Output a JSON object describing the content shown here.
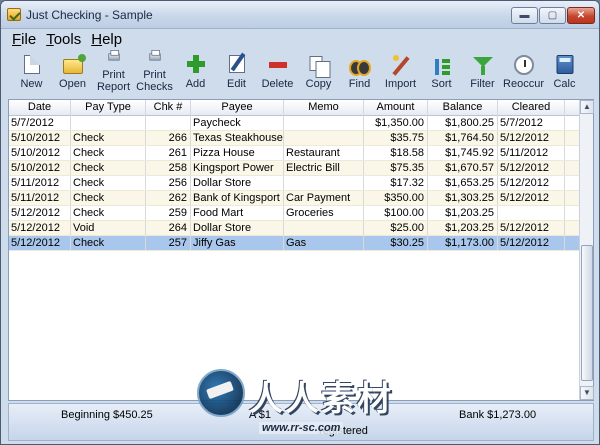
{
  "window": {
    "title": "Just Checking - Sample",
    "buttons": {
      "min": "▬",
      "max": "▢",
      "close": "✕"
    }
  },
  "menu": [
    "File",
    "Tools",
    "Help"
  ],
  "toolbar": [
    {
      "label": "New",
      "icon": "new-document-icon"
    },
    {
      "label": "Open",
      "icon": "open-folder-icon"
    },
    {
      "label": "Print Report",
      "icon": "print-report-icon"
    },
    {
      "label": "Print Checks",
      "icon": "print-checks-icon"
    },
    {
      "label": "Add",
      "icon": "add-plus-icon"
    },
    {
      "label": "Edit",
      "icon": "edit-pencil-icon"
    },
    {
      "label": "Delete",
      "icon": "delete-minus-icon"
    },
    {
      "label": "Copy",
      "icon": "copy-icon"
    },
    {
      "label": "Find",
      "icon": "binoculars-icon"
    },
    {
      "label": "Import",
      "icon": "import-wand-icon"
    },
    {
      "label": "Sort",
      "icon": "sort-icon"
    },
    {
      "label": "Filter",
      "icon": "filter-funnel-icon"
    },
    {
      "label": "Reoccur",
      "icon": "reoccur-clock-icon"
    },
    {
      "label": "Calc",
      "icon": "calculator-icon"
    }
  ],
  "columns": [
    "Date",
    "Pay Type",
    "Chk #",
    "Payee",
    "Memo",
    "Amount",
    "Balance",
    "Cleared"
  ],
  "rows": [
    [
      "5/7/2012",
      "",
      "",
      "Paycheck",
      "",
      "$1,350.00",
      "$1,800.25",
      "5/7/2012"
    ],
    [
      "5/10/2012",
      "Check",
      "266",
      "Texas Steakhouse",
      "",
      "$35.75",
      "$1,764.50",
      "5/12/2012"
    ],
    [
      "5/10/2012",
      "Check",
      "261",
      "Pizza House",
      "Restaurant",
      "$18.58",
      "$1,745.92",
      "5/11/2012"
    ],
    [
      "5/10/2012",
      "Check",
      "258",
      "Kingsport Power",
      "Electric Bill",
      "$75.35",
      "$1,670.57",
      "5/12/2012"
    ],
    [
      "5/11/2012",
      "Check",
      "256",
      "Dollar Store",
      "",
      "$17.32",
      "$1,653.25",
      "5/12/2012"
    ],
    [
      "5/11/2012",
      "Check",
      "262",
      "Bank of Kingsport",
      "Car Payment",
      "$350.00",
      "$1,303.25",
      "5/12/2012"
    ],
    [
      "5/12/2012",
      "Check",
      "259",
      "Food Mart",
      "Groceries",
      "$100.00",
      "$1,203.25",
      ""
    ],
    [
      "5/12/2012",
      "Void",
      "264",
      "Dollar Store",
      "",
      "$25.00",
      "$1,203.25",
      "5/12/2012"
    ],
    [
      "5/12/2012",
      "Check",
      "257",
      "Jiffy Gas",
      "Gas",
      "$30.25",
      "$1,173.00",
      "5/12/2012"
    ]
  ],
  "selected_row": 8,
  "status": {
    "beginning": "Beginning $450.25",
    "middle": "A   $1",
    "bank": "Bank $1,273.00",
    "registered": "registered"
  },
  "watermark": {
    "text": "人人素材",
    "url": "www.rr-sc.com"
  }
}
